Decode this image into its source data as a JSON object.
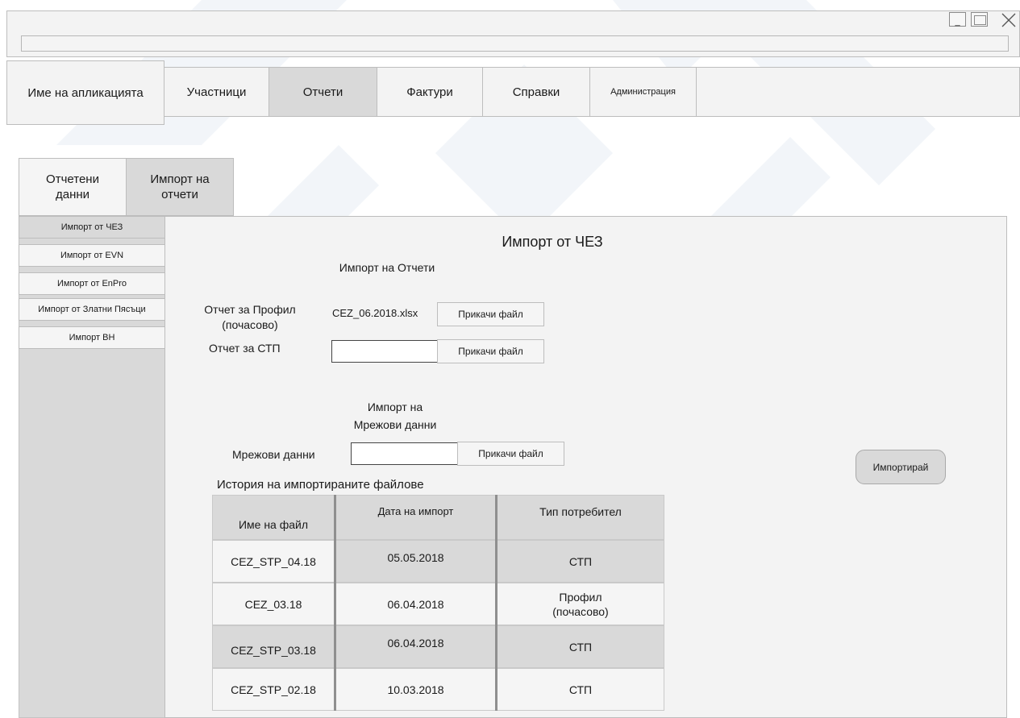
{
  "window": {
    "minimize_label": "_",
    "close_label": "╳"
  },
  "app": {
    "name": "Име на апликацията"
  },
  "nav": {
    "items": [
      {
        "label": "Участници",
        "active": false
      },
      {
        "label": "Отчети",
        "active": true
      },
      {
        "label": "Фактури",
        "active": false
      },
      {
        "label": "Справки",
        "active": false
      },
      {
        "label": "Администрация",
        "active": false
      }
    ]
  },
  "subtabs": [
    {
      "line1": "Отчетени",
      "line2": "данни",
      "active": false
    },
    {
      "line1": "Импорт на",
      "line2": "отчети",
      "active": true
    }
  ],
  "sidebar": {
    "items": [
      {
        "label": "Импорт от ЧЕЗ",
        "active": true
      },
      {
        "label": "Импорт от EVN",
        "active": false
      },
      {
        "label": "Импорт от EnPro",
        "active": false
      },
      {
        "label": "Импорт от Златни Пясъци",
        "active": false
      },
      {
        "label": "Импорт ВН",
        "active": false
      }
    ]
  },
  "main": {
    "title": "Импорт от ЧЕЗ",
    "reports_section": {
      "heading": "Импорт на  Отчети",
      "profile_label_line1": "Отчет за Профил",
      "profile_label_line2": "(почасово)",
      "profile_file": "CEZ_06.2018.xlsx",
      "profile_attach": "Прикачи файл",
      "stp_label": "Отчет за СТП",
      "stp_file": "",
      "stp_attach": "Прикачи файл"
    },
    "network_section": {
      "heading_line1": "Импорт на",
      "heading_line2": "Мрежови данни",
      "label": "Мрежови данни",
      "file": "",
      "attach": "Прикачи файл"
    },
    "import_button": "Импортирай",
    "history": {
      "title": "История на импортираните файлове",
      "columns": [
        "Име на файл",
        "Дата на импорт",
        "Тип потребител"
      ],
      "rows": [
        {
          "file": "CEZ_STP_04.18",
          "date": "05.05.2018",
          "type_line1": "СТП",
          "type_line2": ""
        },
        {
          "file": "CEZ_03.18",
          "date": "06.04.2018",
          "type_line1": "Профил",
          "type_line2": "(почасово)"
        },
        {
          "file": "CEZ_STP_03.18",
          "date": "06.04.2018",
          "type_line1": "СТП",
          "type_line2": ""
        },
        {
          "file": "CEZ_STP_02.18",
          "date": "10.03.2018",
          "type_line1": "СТП",
          "type_line2": ""
        }
      ]
    }
  }
}
